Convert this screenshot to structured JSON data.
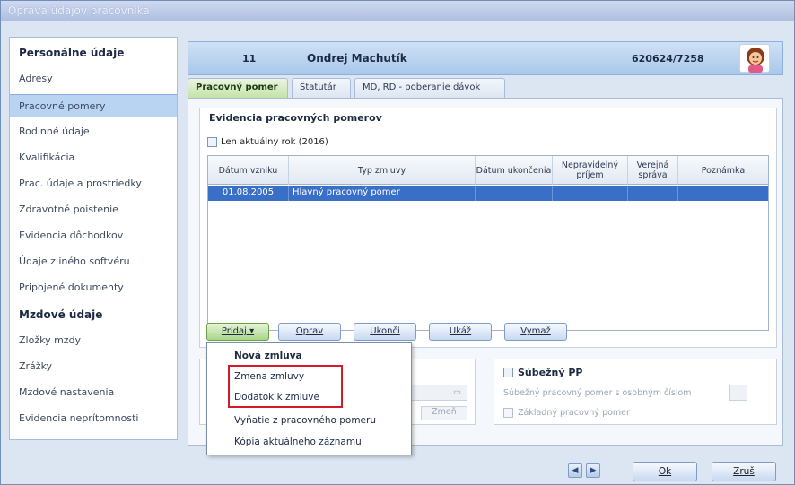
{
  "window": {
    "title": "Oprava údajov pracovníka"
  },
  "sidebar": {
    "section_personal": "Personálne údaje",
    "items_personal": [
      "Adresy",
      "Pracovné pomery",
      "Rodinné údaje",
      "Kvalifikácia",
      "Prac. údaje a prostriedky",
      "Zdravotné poistenie",
      "Evidencia dôchodkov",
      "Údaje z iného softvéru",
      "Pripojené dokumenty"
    ],
    "section_payroll": "Mzdové údaje",
    "items_payroll": [
      "Zložky mzdy",
      "Zrážky",
      "Mzdové nastavenia",
      "Evidencia neprítomnosti"
    ],
    "active_item": "Pracovné pomery"
  },
  "employee": {
    "number": "11",
    "name": "Ondrej Machutík",
    "id": "620624/7258"
  },
  "tabs": [
    "Pracovný pomer",
    "Štatutár",
    "MD, RD - poberanie dávok"
  ],
  "employment": {
    "group_title": "Evidencia pracovných pomerov",
    "checkbox_label": "Len aktuálny rok (2016)",
    "columns": [
      "Dátum vzniku",
      "Typ zmluvy",
      "Dátum ukončenia",
      "Nepravidelný príjem",
      "Verejná správa",
      "Poznámka"
    ],
    "rows": [
      {
        "start": "01.08.2005",
        "type": "Hlavný pracovný pomer",
        "end": "",
        "irregular": "",
        "public": "",
        "note": ""
      }
    ]
  },
  "buttons": {
    "add": "Pridaj",
    "edit": "Oprav",
    "end": "Ukonči",
    "show": "Ukáž",
    "delete": "Vymaž"
  },
  "dropdown": [
    "Nová zmluva",
    "Zmena zmluvy",
    "Dodatok k zmluve",
    "Vyňatie z pracovného pomeru",
    "Kópia aktuálneho záznamu"
  ],
  "concurrent": {
    "title": "Súbežný PP",
    "field_label": "Súbežný pracovný pomer s osobným číslom",
    "base_label": "Základný pracovný pomer"
  },
  "left_lower": {
    "change_label": "Zmeň"
  },
  "footer": {
    "ok": "Ok",
    "cancel": "Zruš"
  }
}
